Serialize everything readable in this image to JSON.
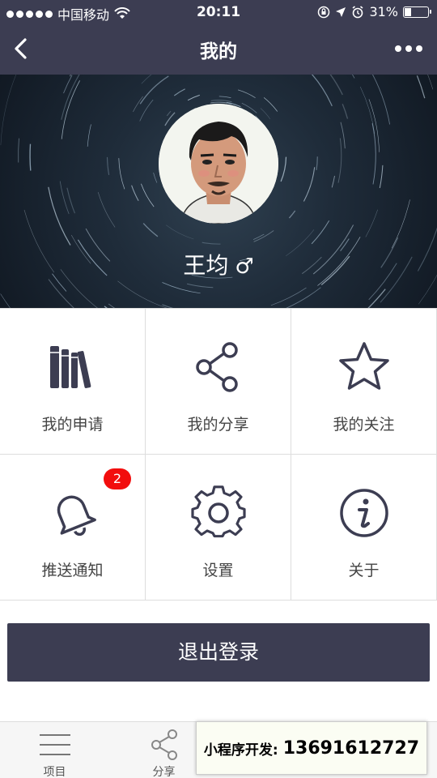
{
  "status_bar": {
    "carrier": "中国移动",
    "time": "20:11",
    "battery": "31%",
    "battery_level": 0.31
  },
  "nav": {
    "title": "我的"
  },
  "profile": {
    "name": "王均",
    "gender_symbol": "♂"
  },
  "grid": [
    {
      "label": "我的申请",
      "icon": "books-icon"
    },
    {
      "label": "我的分享",
      "icon": "share-icon"
    },
    {
      "label": "我的关注",
      "icon": "star-icon"
    },
    {
      "label": "推送通知",
      "icon": "bell-icon",
      "badge": "2"
    },
    {
      "label": "设置",
      "icon": "gear-icon"
    },
    {
      "label": "关于",
      "icon": "info-icon"
    }
  ],
  "logout_label": "退出登录",
  "tabbar": [
    {
      "label": "项目",
      "icon": "menu-icon"
    },
    {
      "label": "分享",
      "icon": "share-icon"
    }
  ],
  "promo": {
    "label": "小程序开发:",
    "phone": "13691612727"
  },
  "colors": {
    "nav_bg": "#3c3d52",
    "badge": "#f20d0d",
    "icon": "#3c3d52"
  }
}
